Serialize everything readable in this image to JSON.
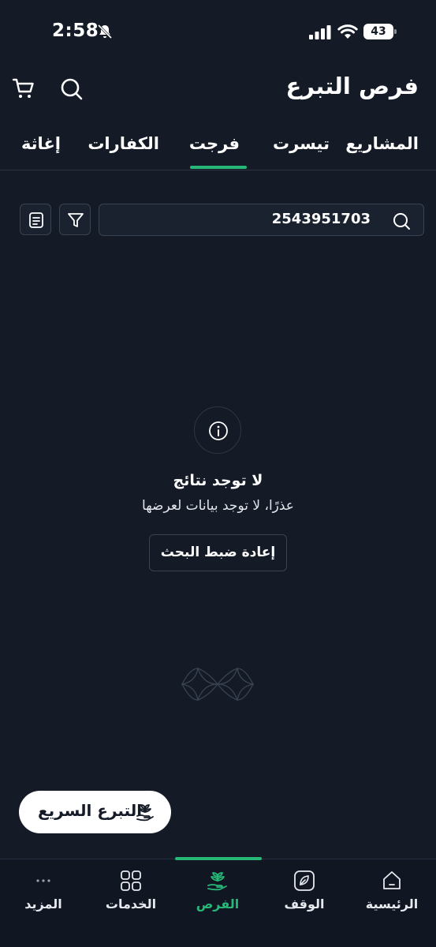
{
  "status": {
    "time": "2:58",
    "battery": "43"
  },
  "header": {
    "title": "فرص التبرع"
  },
  "tabs": [
    {
      "label": "المشاريع"
    },
    {
      "label": "تيسرت"
    },
    {
      "label": "فرجت",
      "active": true
    },
    {
      "label": "الكفارات"
    },
    {
      "label": "إغاثة"
    }
  ],
  "search": {
    "value": "2543951703"
  },
  "empty_state": {
    "title": "لا توجد نتائج",
    "subtitle": "عذرًا، لا توجد بيانات لعرضها",
    "reset_label": "إعادة ضبط البحث"
  },
  "quick_donate": {
    "label": "التبرع السريع"
  },
  "bottom_nav": [
    {
      "label": "الرئيسية",
      "icon": "home-icon"
    },
    {
      "label": "الوقف",
      "icon": "leaf-icon"
    },
    {
      "label": "الفرص",
      "icon": "hand-plant-icon",
      "active": true
    },
    {
      "label": "الخدمات",
      "icon": "grid-icon"
    },
    {
      "label": "المزيد",
      "icon": "more-icon"
    }
  ],
  "colors": {
    "background": "#141b27",
    "accent": "#27b877",
    "border": "#3a4351"
  }
}
